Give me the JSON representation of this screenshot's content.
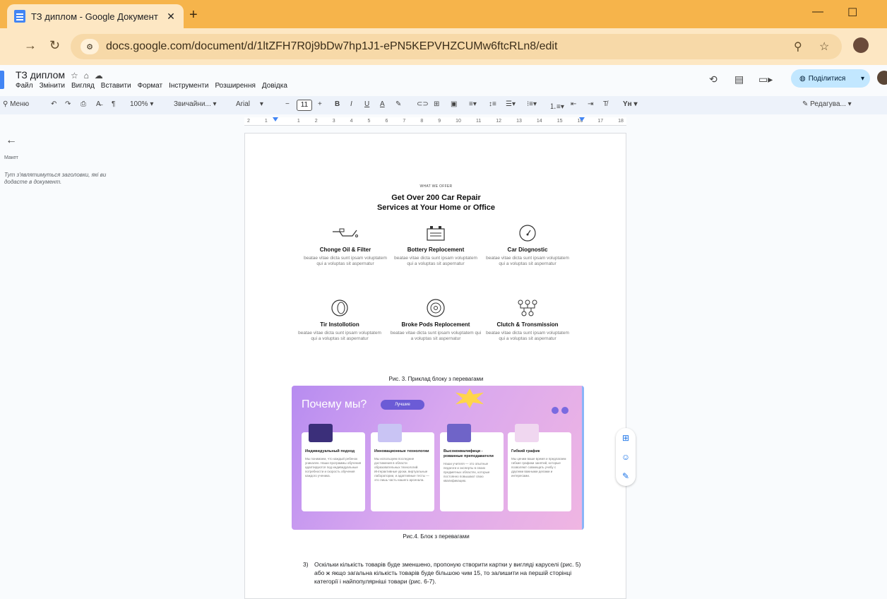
{
  "browser": {
    "tab_title": "ТЗ диплом - Google Документ",
    "tab_close": "✕",
    "new_tab": "+",
    "min": "—",
    "max": "☐",
    "url": "docs.google.com/document/d/1ltZFH7R0j9bDw7hp1J1-ePN5KEPVHZCUMw6ftcRLn8/edit"
  },
  "doc": {
    "title": "ТЗ диплом",
    "menu": [
      "Файл",
      "Змінити",
      "Вигляд",
      "Вставити",
      "Формат",
      "Інструменти",
      "Розширення",
      "Довідка"
    ],
    "share_label": "Поділитися"
  },
  "toolbar": {
    "menu_search": "Меню",
    "zoom": "100%",
    "style": "Звичайни...",
    "font": "Arial",
    "font_size": "11",
    "edit_mode": "Редагува..."
  },
  "ruler": {
    "ticks": [
      "2",
      "1",
      "",
      "1",
      "2",
      "3",
      "4",
      "5",
      "6",
      "7",
      "8",
      "9",
      "10",
      "11",
      "12",
      "13",
      "14",
      "15",
      "16",
      "17",
      "18"
    ]
  },
  "outline": {
    "label": "Макет",
    "hint": "Тут з'являтимуться заголовки, які ви додасте в документ."
  },
  "content": {
    "what_we_offer": "WHAT WE OFFER",
    "heading_line1": "Get Over 200 Car Repair",
    "heading_line2": "Services at Your Home or Office",
    "services": [
      {
        "name": "Chonge Oil & Filter",
        "desc": "beatae vitae dicta sunt ipsam voluptatem qui a voluptas sit aspernatur"
      },
      {
        "name": "Bottery Replocement",
        "desc": "beatae vitae dicta sunt ipsam voluptatem qui a voluptas sit aspernatur"
      },
      {
        "name": "Car Diognostic",
        "desc": "beatae vitae dicta sunt ipsam voluptatem qui a voluptas sit aspernatur"
      },
      {
        "name": "Tir Instollotion",
        "desc": "beatae vitae dicta sunt ipsam voluptatem qui a voluptas sit aspernatur"
      },
      {
        "name": "Broke Pods Replocement",
        "desc": "beatae vitae dicta sunt ipsam voluptatem qui a voluptas sit aspernatur"
      },
      {
        "name": "Clutch & Tronsmission",
        "desc": "beatae vitae dicta sunt ipsam voluptatem qui a voluptas sit aspernatur"
      }
    ],
    "caption1": "Рис. 3. Приклад блоку з перевагами",
    "banner": {
      "title": "Почему мы?",
      "pill": "Лучшие",
      "cards": [
        {
          "title": "Индивидуальный подход",
          "desc": "Мы понимаем, что каждый ребенок уникален. Наши программы обучения адаптируются под индивидуальные потребности и скорость обучения каждого ученика."
        },
        {
          "title": "Инновационные технологии",
          "desc": "Мы используем последние достижения в области образовательных технологий. Интерактивные уроки, виртуальные лаборатории, и адаптивные тесты — это лишь часть нашего арсенала."
        },
        {
          "title": "Высококвалифици - рованные преподаватели",
          "desc": "Наши учителя — это опытные педагоги и эксперты в своих предметных областях, которые постоянно повышают свою квалификацию."
        },
        {
          "title": "Гибкий график",
          "desc": "Мы ценим ваше время и предлагаем гибкие графики занятий, которые позволяют совмещать учебу с другими важными делами и интересами."
        }
      ]
    },
    "caption2": "Рис.4.  Блок з перевагами",
    "para_num": "3)",
    "para_text": "Оскільки кількість товарів буде зменшено, пропоную створити картки у вигляді каруселі (рис. 5) або ж якщо загальна кількість товарів буде більшою чим 15, то залишити на першій сторінці категорії і найпопулярніші товари (рис. 6-7)."
  }
}
